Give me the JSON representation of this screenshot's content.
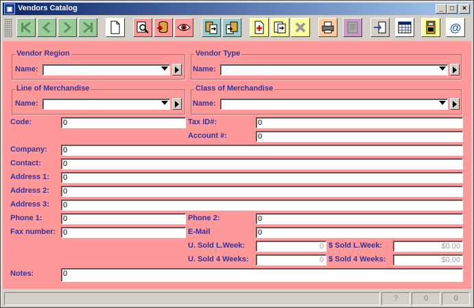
{
  "window": {
    "title": "Vendors Catalog",
    "icon": "app-logo-icon"
  },
  "title_buttons": [
    "minimize-icon",
    "maximize-icon",
    "close-icon"
  ],
  "toolbar": {
    "buttons": [
      {
        "icon": "first-record-icon",
        "bg": "#99cc99"
      },
      {
        "icon": "previous-record-icon",
        "bg": "#99cc99"
      },
      {
        "icon": "next-record-icon",
        "bg": "#99cc99"
      },
      {
        "icon": "last-record-icon",
        "bg": "#99cc99"
      },
      {
        "icon": "new-document-icon",
        "bg": "#ffffff"
      },
      {
        "icon": "find-icon",
        "bg": "#ff9999"
      },
      {
        "icon": "database-icon",
        "bg": "#ff9999"
      },
      {
        "icon": "view-icon",
        "bg": "#ff9999"
      },
      {
        "icon": "export-icon",
        "bg": "#99cccc"
      },
      {
        "icon": "import-icon",
        "bg": "#99cccc"
      },
      {
        "icon": "add-record-icon",
        "bg": "#ffff99"
      },
      {
        "icon": "save-record-icon",
        "bg": "#ffff99"
      },
      {
        "icon": "delete-record-icon",
        "bg": "#ffff99"
      },
      {
        "icon": "print-icon",
        "bg": "#ffcc99"
      },
      {
        "icon": "report-icon",
        "bg": "#cc99cc"
      },
      {
        "icon": "exit-icon",
        "bg": "#d4d0c8"
      },
      {
        "icon": "calendar-icon",
        "bg": "#ffffff"
      },
      {
        "icon": "calculator-icon",
        "bg": "#ffff99"
      },
      {
        "icon": "email-icon",
        "bg": "#ffffff"
      }
    ]
  },
  "colors": {
    "form_bg": "#ff9999",
    "label": "#333399",
    "group_border": "#b56a6a"
  },
  "groups": {
    "vendor_region": {
      "title": "Vendor Region",
      "name_label": "Name:",
      "value": ""
    },
    "vendor_type": {
      "title": "Vendor Type",
      "name_label": "Name:",
      "value": ""
    },
    "line_of_merchandise": {
      "title": "Line of Merchandise",
      "name_label": "Name:",
      "value": ""
    },
    "class_of_merchandise": {
      "title": "Class of Merchandise",
      "name_label": "Name:",
      "value": ""
    }
  },
  "fields": {
    "code": {
      "label": "Code:",
      "value": "0"
    },
    "tax_id": {
      "label": "Tax ID#:",
      "value": "0"
    },
    "account": {
      "label": "Account #:",
      "value": "0"
    },
    "company": {
      "label": "Company:",
      "value": "0"
    },
    "contact": {
      "label": "Contact:",
      "value": "0"
    },
    "address1": {
      "label": "Address 1:",
      "value": "0"
    },
    "address2": {
      "label": "Address 2:",
      "value": "0"
    },
    "address3": {
      "label": "Address 3:",
      "value": "0"
    },
    "phone1": {
      "label": "Phone 1:",
      "value": "0"
    },
    "phone2": {
      "label": "Phone 2:",
      "value": "0"
    },
    "fax": {
      "label": "Fax number:",
      "value": "0"
    },
    "email": {
      "label": "E-Mail",
      "value": "0"
    },
    "units_sold_week": {
      "label": "U. Sold L.Week:",
      "value": "0"
    },
    "dollars_sold_week": {
      "label": "$ Sold L.Week:",
      "value": "$0.00"
    },
    "units_sold_4weeks": {
      "label": "U. Sold 4 Weeks:",
      "value": "0"
    },
    "dollars_sold_4weeks": {
      "label": "$ Sold 4 Weeks:",
      "value": "$0.00"
    },
    "notes": {
      "label": "Notes:",
      "value": "0"
    }
  },
  "status": {
    "main": "",
    "help": "?",
    "count1": "0",
    "count2": "0"
  }
}
